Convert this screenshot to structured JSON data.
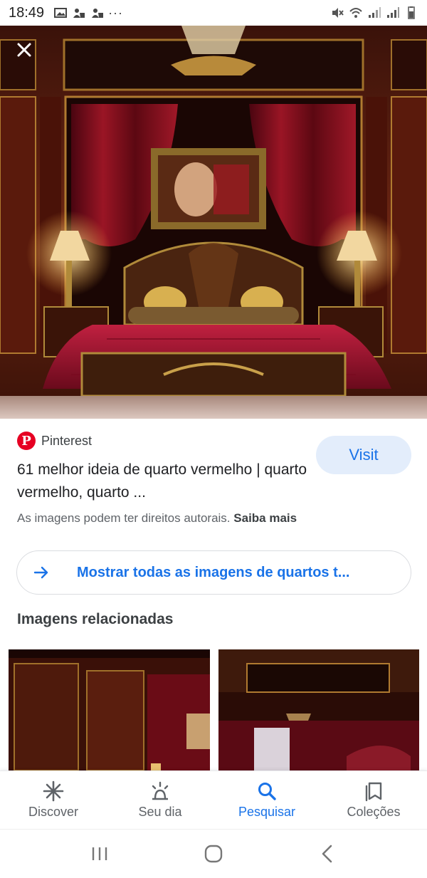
{
  "status_bar": {
    "time": "18:49",
    "left_icons": [
      "gallery-icon",
      "person-icon",
      "person-icon"
    ],
    "more": "···",
    "right_icons": [
      "mute-icon",
      "wifi-icon",
      "signal-icon",
      "signal-icon",
      "battery-icon"
    ]
  },
  "viewer": {
    "close_icon": "close-icon",
    "image_subject": "bedroom"
  },
  "result": {
    "source_name": "Pinterest",
    "source_logo_letter": "P",
    "visit_label": "Visit",
    "title": "61 melhor ideia de quarto vermelho | quarto vermelho, quarto ...",
    "copyright_text": "As imagens podem ter direitos autorais.",
    "learn_more": "Saiba mais"
  },
  "show_all": {
    "label": "Mostrar todas as imagens de quartos t..."
  },
  "related": {
    "heading": "Imagens relacionadas"
  },
  "bottom_nav": {
    "items": [
      {
        "label": "Discover",
        "icon": "discover-icon"
      },
      {
        "label": "Seu dia",
        "icon": "sun-icon"
      },
      {
        "label": "Pesquisar",
        "icon": "search-icon",
        "active": true
      },
      {
        "label": "Coleções",
        "icon": "bookmark-icon"
      }
    ]
  },
  "colors": {
    "accent": "#1a73e8",
    "pinterest_red": "#e60023",
    "visit_bg": "#e3edfb"
  }
}
